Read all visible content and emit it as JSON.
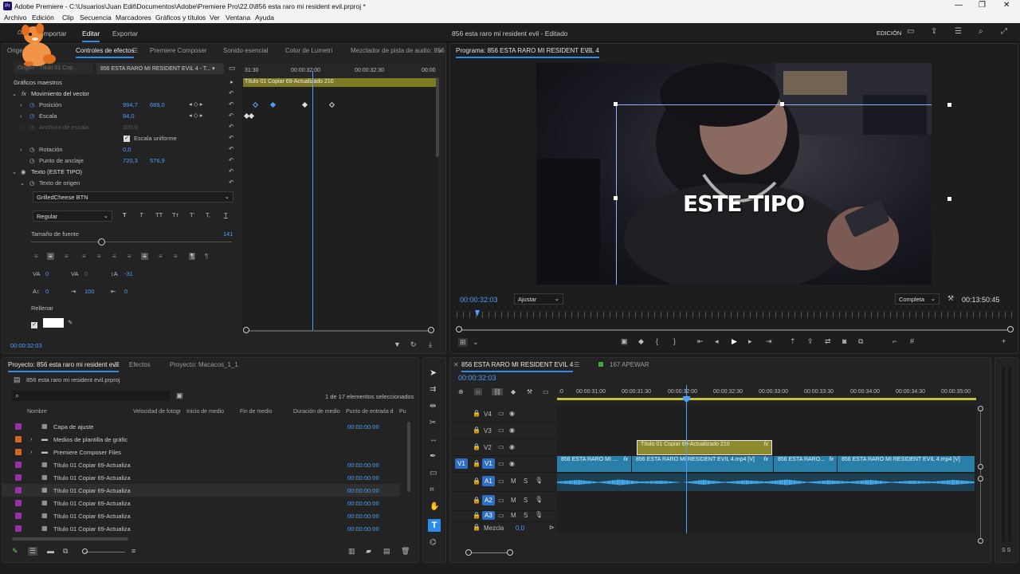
{
  "app": {
    "title": "Adobe Premiere - C:\\Usuarios\\Juan Edit\\Documentos\\Adobe\\Premiere Pro\\22.0\\856 esta raro mi resident evil.prproj *",
    "logo": "Pr"
  },
  "menu": [
    "Archivo",
    "Edición",
    "Clip",
    "Secuencia",
    "Marcadores",
    "Gráficos y títulos",
    "Ver",
    "Ventana",
    "Ayuda"
  ],
  "workspace": {
    "tabs": [
      "Importar",
      "Editar",
      "Exportar"
    ],
    "active": "Editar",
    "center_title": "856 esta raro mi resident evil",
    "center_status": "Editado",
    "mode": "EDICIÓN"
  },
  "effects_panel": {
    "tabs": [
      "Origen",
      "Controles de efectos",
      "Premiere Composer",
      "Sonido esencial",
      "Color de Lumetri",
      "Mezclador de pista de audio: 856"
    ],
    "source_label": "Origen - Título 01 Cop...",
    "clip_label": "856 ESTA RARO MI RESIDENT EVIL 4 - T...",
    "graphics_label": "Gráficos maestros",
    "motion": "Movimiento del vector",
    "position": {
      "label": "Posición",
      "x": "994,7",
      "y": "689,0"
    },
    "scale": {
      "label": "Escala",
      "value": "84,0"
    },
    "scale_width": {
      "label": "Anchura de escala",
      "value": "100,0"
    },
    "uniform": "Escala uniforme",
    "rotation": {
      "label": "Rotación",
      "value": "0,0"
    },
    "anchor": {
      "label": "Punto de anclaje",
      "x": "720,3",
      "y": "576,9"
    },
    "text_layer": "Texto (ESTE TIPO)",
    "source_text": "Texto de origen",
    "font": "GrilledCheese BTN",
    "font_style": "Regular",
    "style_buttons": [
      "T",
      "T",
      "TT",
      "Tт",
      "T'",
      "T,",
      "T"
    ],
    "font_size": {
      "label": "Tamaño de fuente",
      "value": "141"
    },
    "metrics": {
      "kerning": "0",
      "tracking": "0",
      "leading": "-31",
      "baseline": "0",
      "tsume": "100",
      "tab": "0"
    },
    "fill": "Rellenar",
    "timecode": "00:00:32:03",
    "ruler": [
      "31:30",
      "00:00:32:00",
      "00:00:32:30",
      "00:00"
    ],
    "clip_bar": "Título 01 Copiar 69-Actualizado 210"
  },
  "program": {
    "title": "Programa: 856 ESTA RARO MI RESIDENT EVIL 4",
    "overlay_text": "ESTE TIPO",
    "timecode": "00:00:32:03",
    "fit": "Ajustar",
    "quality": "Completa",
    "duration": "00:13:50:45"
  },
  "project": {
    "tabs": [
      "Proyecto: 856 esta raro mi resident evil",
      "Efectos",
      "Proyecto: Macacos_1_1"
    ],
    "file": "856 esta raro mi resident evil.prproj",
    "selection": "1 de 17 elementos seleccionados",
    "columns": [
      "Nombre",
      "Velocidad de fotogr",
      "Inicio de medio",
      "Fin de medio",
      "Duración de medio",
      "Punto de entrada d",
      "Pu"
    ],
    "rows": [
      {
        "name": "Capa de ajuste",
        "color": "#9b2fa8",
        "inpoint": "00:00:00:00",
        "folder": false
      },
      {
        "name": "Medios de plantilla de gráfic",
        "color": "#d2691e",
        "inpoint": "",
        "folder": true
      },
      {
        "name": "Premiere Composer Files",
        "color": "#d2691e",
        "inpoint": "",
        "folder": true
      },
      {
        "name": "Título 01 Copiar 69-Actualiza",
        "color": "#9b2fa8",
        "inpoint": "00:00:00:00",
        "folder": false
      },
      {
        "name": "Título 01 Copiar 69-Actualiza",
        "color": "#9b2fa8",
        "inpoint": "00:00:00:00",
        "folder": false
      },
      {
        "name": "Título 01 Copiar 69-Actualiza",
        "color": "#9b2fa8",
        "inpoint": "00:00:00:00",
        "folder": false
      },
      {
        "name": "Título 01 Copiar 69-Actualiza",
        "color": "#9b2fa8",
        "inpoint": "00:00:00:00",
        "folder": false
      },
      {
        "name": "Título 01 Copiar 69-Actualiza",
        "color": "#9b2fa8",
        "inpoint": "00:00:00:00",
        "folder": false
      },
      {
        "name": "Título 01 Copiar 69-Actualiza",
        "color": "#9b2fa8",
        "inpoint": "00:00:00:00",
        "folder": false
      }
    ]
  },
  "timeline": {
    "tabs": [
      "856 ESTA RARO MI RESIDENT EVIL 4",
      "167 APEWAR"
    ],
    "timecode": "00:00:32:03",
    "ruler": [
      ":0",
      "00:00:31:00",
      "00:00:31:30",
      "00:00:32:00",
      "00:00:32:30",
      "00:00:33:00",
      "00:00:33:30",
      "00:00:34:00",
      "00:00:34:30",
      "00:00:35:00"
    ],
    "video_tracks": [
      "V4",
      "V3",
      "V2",
      "V1"
    ],
    "audio_tracks": [
      "A1",
      "A2",
      "A3"
    ],
    "mix": {
      "label": "Mezcla",
      "value": "0,0"
    },
    "clips": {
      "title": "Título 01 Copiar 69-Actualizado 210",
      "v1": [
        "856 ESTA RARO MI ...",
        "856 ESTA RARO MI RESIDENT EVIL 4.mp4 [V]",
        "856 ESTA RARO...",
        "856 ESTA RARO MI RESIDENT EVIL 4.mp4 [V]"
      ]
    }
  },
  "meter": "S S",
  "colors": {
    "accent": "#2d8ceb",
    "title_clip": "#8e8a2f",
    "video_clip": "#2a7fa8",
    "audio_wave": "#3fa0e0",
    "label_purple": "#9b2fa8",
    "label_orange": "#d2691e"
  }
}
